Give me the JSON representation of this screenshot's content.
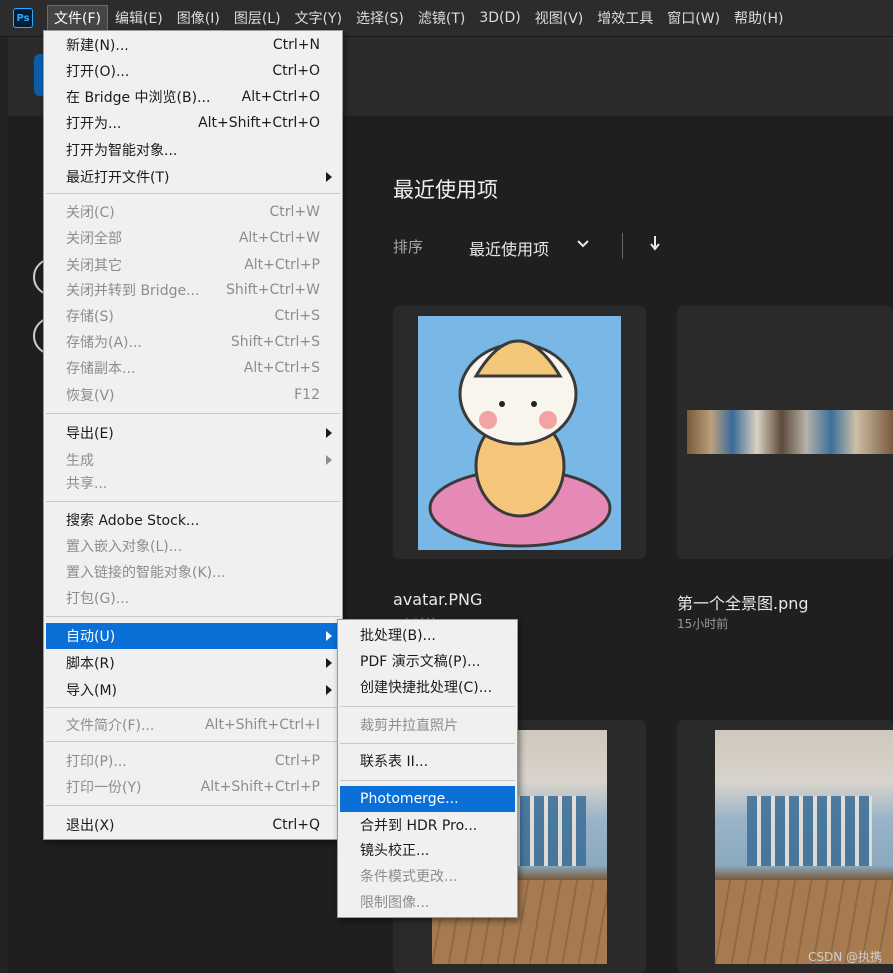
{
  "menubar": {
    "logo": "Ps",
    "items": [
      "文件(F)",
      "编辑(E)",
      "图像(I)",
      "图层(L)",
      "文字(Y)",
      "选择(S)",
      "滤镜(T)",
      "3D(D)",
      "视图(V)",
      "增效工具",
      "窗口(W)",
      "帮助(H)"
    ]
  },
  "home": {
    "recent_title": "最近使用项",
    "sort_label": "排序",
    "sort_value": "最近使用项",
    "files": [
      {
        "name": "avatar.PNG",
        "time": "1小时前"
      },
      {
        "name": "第一个全景图.png",
        "time": "15小时前"
      }
    ],
    "watermark": "CSDN @执携"
  },
  "file_menu": {
    "items": [
      {
        "label": "新建(N)...",
        "shortcut": "Ctrl+N",
        "enabled": true
      },
      {
        "label": "打开(O)...",
        "shortcut": "Ctrl+O",
        "enabled": true
      },
      {
        "label": "在 Bridge 中浏览(B)...",
        "shortcut": "Alt+Ctrl+O",
        "enabled": true
      },
      {
        "label": "打开为...",
        "shortcut": "Alt+Shift+Ctrl+O",
        "enabled": true
      },
      {
        "label": "打开为智能对象...",
        "shortcut": "",
        "enabled": true
      },
      {
        "label": "最近打开文件(T)",
        "shortcut": "",
        "enabled": true,
        "submenu": true
      },
      {
        "label": "关闭(C)",
        "shortcut": "Ctrl+W",
        "enabled": false
      },
      {
        "label": "关闭全部",
        "shortcut": "Alt+Ctrl+W",
        "enabled": false
      },
      {
        "label": "关闭其它",
        "shortcut": "Alt+Ctrl+P",
        "enabled": false
      },
      {
        "label": "关闭并转到 Bridge...",
        "shortcut": "Shift+Ctrl+W",
        "enabled": false
      },
      {
        "label": "存储(S)",
        "shortcut": "Ctrl+S",
        "enabled": false
      },
      {
        "label": "存储为(A)...",
        "shortcut": "Shift+Ctrl+S",
        "enabled": false
      },
      {
        "label": "存储副本...",
        "shortcut": "Alt+Ctrl+S",
        "enabled": false
      },
      {
        "label": "恢复(V)",
        "shortcut": "F12",
        "enabled": false
      },
      {
        "label": "导出(E)",
        "shortcut": "",
        "enabled": true,
        "submenu": true
      },
      {
        "label": "生成",
        "shortcut": "",
        "enabled": false,
        "submenu": true
      },
      {
        "label": "共享...",
        "shortcut": "",
        "enabled": false
      },
      {
        "label": "搜索 Adobe Stock...",
        "shortcut": "",
        "enabled": true
      },
      {
        "label": "置入嵌入对象(L)...",
        "shortcut": "",
        "enabled": false
      },
      {
        "label": "置入链接的智能对象(K)...",
        "shortcut": "",
        "enabled": false
      },
      {
        "label": "打包(G)...",
        "shortcut": "",
        "enabled": false
      },
      {
        "label": "自动(U)",
        "shortcut": "",
        "enabled": true,
        "submenu": true,
        "highlighted": true
      },
      {
        "label": "脚本(R)",
        "shortcut": "",
        "enabled": true,
        "submenu": true
      },
      {
        "label": "导入(M)",
        "shortcut": "",
        "enabled": true,
        "submenu": true
      },
      {
        "label": "文件简介(F)...",
        "shortcut": "Alt+Shift+Ctrl+I",
        "enabled": false
      },
      {
        "label": "打印(P)...",
        "shortcut": "Ctrl+P",
        "enabled": false
      },
      {
        "label": "打印一份(Y)",
        "shortcut": "Alt+Shift+Ctrl+P",
        "enabled": false
      },
      {
        "label": "退出(X)",
        "shortcut": "Ctrl+Q",
        "enabled": true
      }
    ]
  },
  "auto_submenu": {
    "items": [
      {
        "label": "批处理(B)...",
        "enabled": true
      },
      {
        "label": "PDF 演示文稿(P)...",
        "enabled": true
      },
      {
        "label": "创建快捷批处理(C)...",
        "enabled": true
      },
      {
        "label": "裁剪并拉直照片",
        "enabled": false
      },
      {
        "label": "联系表 II...",
        "enabled": true
      },
      {
        "label": "Photomerge...",
        "enabled": true,
        "highlighted": true
      },
      {
        "label": "合并到 HDR Pro...",
        "enabled": true
      },
      {
        "label": "镜头校正...",
        "enabled": true
      },
      {
        "label": "条件模式更改...",
        "enabled": false
      },
      {
        "label": "限制图像...",
        "enabled": false
      }
    ]
  }
}
